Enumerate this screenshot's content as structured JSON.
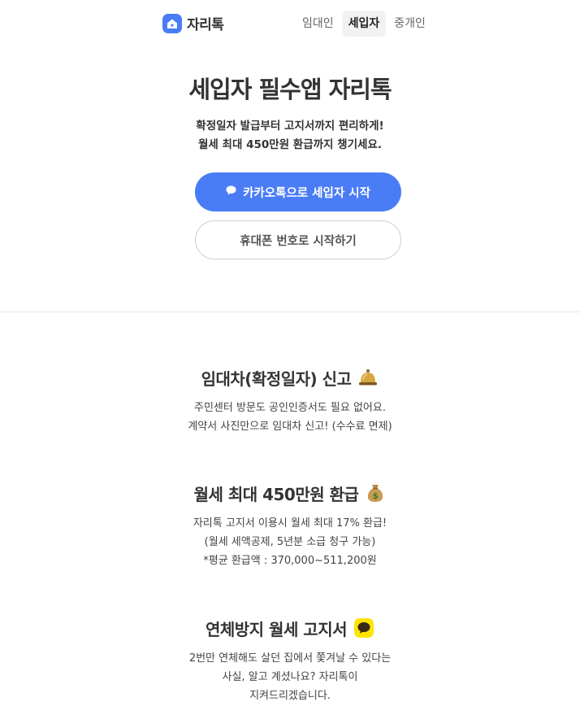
{
  "header": {
    "logo_text": "자리톡",
    "tabs": [
      {
        "label": "임대인",
        "active": false
      },
      {
        "label": "세입자",
        "active": true
      },
      {
        "label": "중개인",
        "active": false
      }
    ]
  },
  "hero": {
    "title": "세입자 필수앱 자리톡",
    "subtitle_line1": "확정일자 발급부터 고지서까지 편리하게!",
    "subtitle_line2": "월세 최대 450만원 환급까지 챙기세요.",
    "kakao_button": "카카오톡으로 세입자 시작",
    "phone_button": "휴대폰 번호로 시작하기"
  },
  "features": [
    {
      "title": "임대차(확정일자) 신고",
      "icon": "bell-icon",
      "lines": [
        "주민센터 방문도 공인인증서도 필요 없어요.",
        "계약서 사진만으로 임대차 신고! (수수료 면제)"
      ]
    },
    {
      "title": "월세 최대 450만원 환급",
      "icon": "money-bag-icon",
      "lines": [
        "자리톡 고지서 이용시 월세 최대 17% 환급!",
        "(월세 세액공제, 5년분 소급 청구 가능)",
        "*평균 환급액 : 370,000~511,200원"
      ]
    },
    {
      "title": "연체방지 월세 고지서",
      "icon": "chat-bubble-icon",
      "lines": [
        "2번만 연체해도 살던 집에서 쫓겨날 수 있다는",
        "사실, 알고 계셨나요? 자리톡이",
        "지켜드리겠습니다."
      ]
    }
  ],
  "colors": {
    "accent": "#4a7cf6",
    "kakao_yellow": "#fee500"
  }
}
